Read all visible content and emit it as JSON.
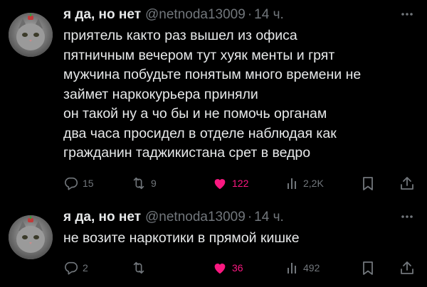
{
  "tweets": [
    {
      "author": {
        "display_name": "я да, но нет",
        "handle": "@netnoda13009",
        "separator": "·",
        "time": "14 ч."
      },
      "lines": [
        "приятель както раз вышел из офиса",
        "пятничным вечером тут хуяк менты и грят",
        "мужчина побудьте понятым много времени не",
        "займет наркокурьера приняли",
        "он такой ну а чо бы и не помочь органам",
        "два часа просидел в отделе наблюдая как",
        "гражданин таджикистана срет в ведро"
      ],
      "actions": {
        "replies": "15",
        "retweets": "9",
        "likes": "122",
        "views": "2,2K"
      }
    },
    {
      "author": {
        "display_name": "я да, но нет",
        "handle": "@netnoda13009",
        "separator": "·",
        "time": "14 ч."
      },
      "lines": [
        "не возите наркотики в прямой кишке"
      ],
      "actions": {
        "replies": "2",
        "retweets": "",
        "likes": "36",
        "views": "492"
      }
    }
  ],
  "colors": {
    "background": "#000000",
    "text": "#e7e9ea",
    "muted": "#71767b",
    "like": "#f91880"
  },
  "icons": [
    "avatar",
    "more-icon",
    "reply-icon",
    "retweet-icon",
    "heart-filled-icon",
    "views-icon",
    "bookmark-icon",
    "share-icon"
  ]
}
